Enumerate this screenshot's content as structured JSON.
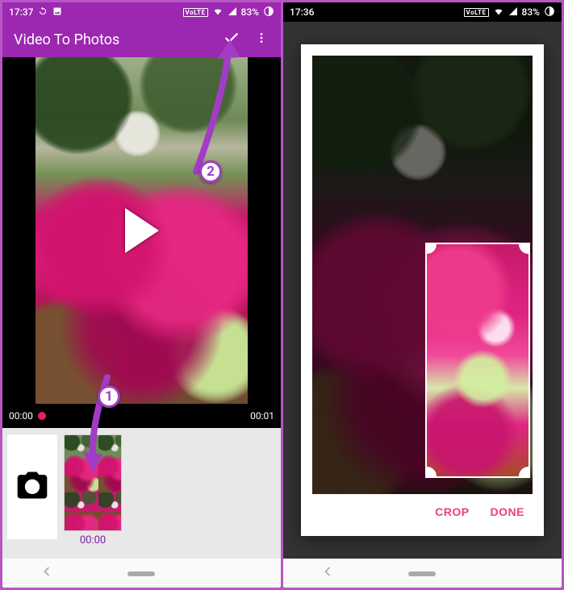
{
  "left": {
    "status": {
      "time": "17:37",
      "volte": "VoLTE",
      "battery": "83%"
    },
    "appbar": {
      "title": "Video To Photos"
    },
    "timeline": {
      "start": "00:00",
      "end": "00:01"
    },
    "thumbs": [
      {
        "time": "00:00"
      }
    ],
    "annot": {
      "num1": "1",
      "num2": "2"
    }
  },
  "right": {
    "status": {
      "time": "17:36",
      "volte": "VoLTE",
      "battery": "83%"
    },
    "dialog": {
      "crop_label": "CROP",
      "done_label": "DONE"
    }
  }
}
